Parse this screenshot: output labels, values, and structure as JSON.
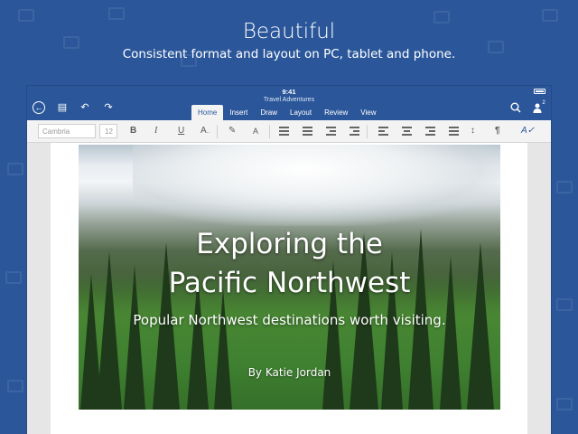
{
  "promo": {
    "title": "Beautiful",
    "subtitle": "Consistent format and layout on PC, tablet and phone."
  },
  "status": {
    "time": "9:41"
  },
  "document": {
    "title": "Travel Adventures"
  },
  "tabs": [
    {
      "label": "Home",
      "active": true
    },
    {
      "label": "Insert",
      "active": false
    },
    {
      "label": "Draw",
      "active": false
    },
    {
      "label": "Layout",
      "active": false
    },
    {
      "label": "Review",
      "active": false
    },
    {
      "label": "View",
      "active": false
    }
  ],
  "header_icons": {
    "back": "back-circle-icon",
    "file": "file-icon",
    "undo": "undo-icon",
    "redo": "redo-icon",
    "search": "search-icon",
    "share": "share-people-icon",
    "share_count": "2"
  },
  "ribbon": {
    "font_name": "Cambria",
    "font_size": "12",
    "bold": "B",
    "italic": "I",
    "underline": "U",
    "text_effects": "A",
    "font_color": "A",
    "paragraph_mark": "¶"
  },
  "cover": {
    "title_line1": "Exploring the",
    "title_line2": "Pacific Northwest",
    "subtitle": "Popular Northwest destinations worth visiting.",
    "author": "By Katie Jordan"
  },
  "colors": {
    "brand_blue": "#2b579a",
    "ribbon_bg": "#f3f3f3"
  }
}
